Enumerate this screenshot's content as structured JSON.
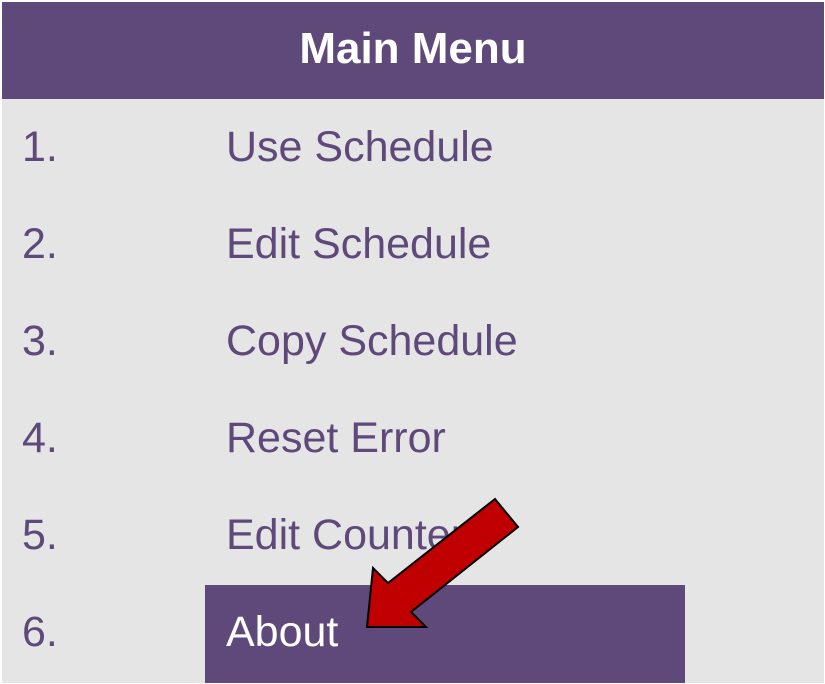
{
  "menu": {
    "title": "Main Menu",
    "items": [
      {
        "number": "1.",
        "label": "Use Schedule",
        "selected": false
      },
      {
        "number": "2.",
        "label": "Edit Schedule",
        "selected": false
      },
      {
        "number": "3.",
        "label": "Copy Schedule",
        "selected": false
      },
      {
        "number": "4.",
        "label": "Reset Error",
        "selected": false
      },
      {
        "number": "5.",
        "label": "Edit Counter",
        "selected": false
      },
      {
        "number": "6.",
        "label": "About",
        "selected": true
      }
    ]
  },
  "annotation": {
    "icon": "arrow-pointer-icon",
    "fill_color": "#c00000",
    "outline_color": "#000000"
  },
  "colors": {
    "accent": "#5e497a",
    "panel_background": "#e6e5e6",
    "text_on_accent": "#ffffff"
  }
}
